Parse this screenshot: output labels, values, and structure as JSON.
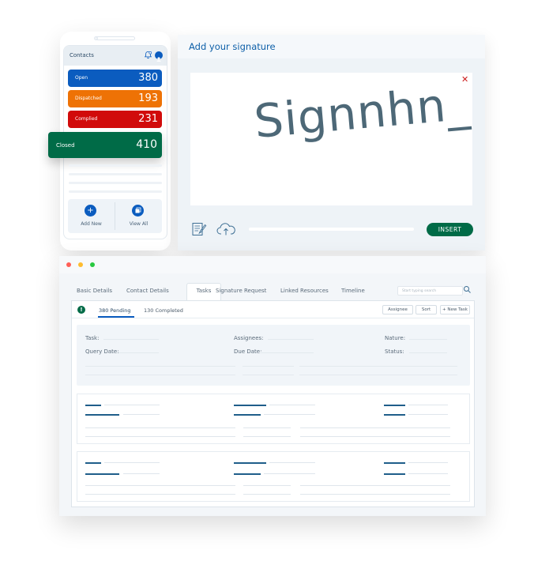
{
  "phone": {
    "title": "Contacts",
    "stats": [
      {
        "label": "Open",
        "count": "380",
        "color": "#0b5cbf"
      },
      {
        "label": "Dispatched",
        "count": "193",
        "color": "#ee7205"
      },
      {
        "label": "Complied",
        "count": "231",
        "color": "#d10b0b"
      },
      {
        "label": "Closed",
        "count": "410",
        "color": "#006b47"
      }
    ],
    "actions": [
      {
        "label": "Add New",
        "icon": "plus-icon"
      },
      {
        "label": "View All",
        "icon": "stack-icon"
      }
    ]
  },
  "signature": {
    "title": "Add your signature",
    "signature_text": "Signnhn_",
    "close_label": "✕",
    "insert_label": "INSERT"
  },
  "window": {
    "tabs": [
      "Basic Details",
      "Contact Details",
      "Tasks",
      "Signature Request",
      "Linked Resources",
      "Timeline"
    ],
    "active_tab": "Tasks",
    "search_placeholder": "Start typing search",
    "subtabs": [
      "380 Pending",
      "130 Completed"
    ],
    "buttons": {
      "assignee": "Assignee",
      "sort": "Sort",
      "new_task": "+ New Task"
    },
    "fields": {
      "task": "Task:",
      "assignees": "Assignees:",
      "nature": "Nature:",
      "query_date": "Query Date:",
      "due_date": "Due Date:",
      "status": "Status:"
    }
  },
  "colors": {
    "brand_blue": "#0b5cbf",
    "brand_green": "#006b47",
    "orange": "#ee7205",
    "red": "#d10b0b"
  }
}
